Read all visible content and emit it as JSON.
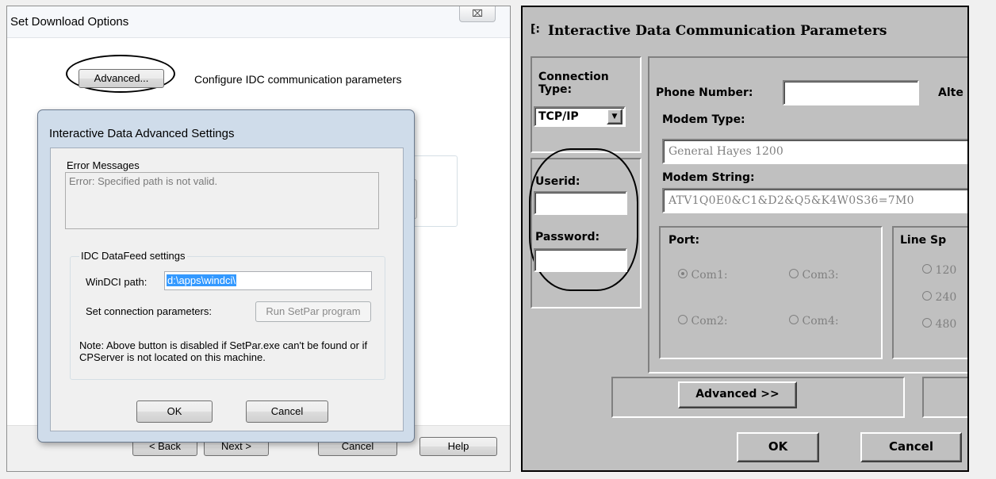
{
  "left_dialog": {
    "title": "Set Download Options",
    "close_glyph": "⌧",
    "advanced_label": "Advanced...",
    "advanced_caption": "Configure IDC communication parameters",
    "bottom_buttons": {
      "back": "< Back",
      "next": "Next >",
      "cancel": "Cancel",
      "help": "Help"
    }
  },
  "advanced_dialog": {
    "title": "Interactive Data Advanced Settings",
    "error_group_label": "Error Messages",
    "error_text": "Error: Specified path is not valid.",
    "idc_group_label": "IDC DataFeed settings",
    "windci_label": "WinDCI path:",
    "windci_value": "d:\\apps\\windci\\",
    "connection_label": "Set connection parameters:",
    "run_setpar_label": "Run SetPar program",
    "note": "Note: Above button is disabled if SetPar.exe can't be found or if CPServer is not located on this machine.",
    "ok_label": "OK",
    "cancel_label": "Cancel"
  },
  "idc_dialog": {
    "title": "Interactive Data Communication Parameters",
    "title_icon_glyph": "⁅:",
    "connection_type_label": "Connection Type:",
    "connection_type_value": "TCP/IP",
    "userid_label": "Userid:",
    "password_label": "Password:",
    "phone_number_label": "Phone Number:",
    "alternate_label": "Alte",
    "modem_type_label": "Modem Type:",
    "modem_type_value": "General Hayes 1200",
    "modem_string_label": "Modem String:",
    "modem_string_value": "ATV1Q0E0&C1&D2&Q5&K4W0S36=7M0",
    "port_label": "Port:",
    "ports": [
      "Com1:",
      "Com3:",
      "Com2:",
      "Com4:"
    ],
    "line_speed_label": "Line Sp",
    "speeds": [
      "120",
      "240",
      "480"
    ],
    "advanced_label": "Advanced >>",
    "ok_label": "OK",
    "cancel_label": "Cancel"
  }
}
